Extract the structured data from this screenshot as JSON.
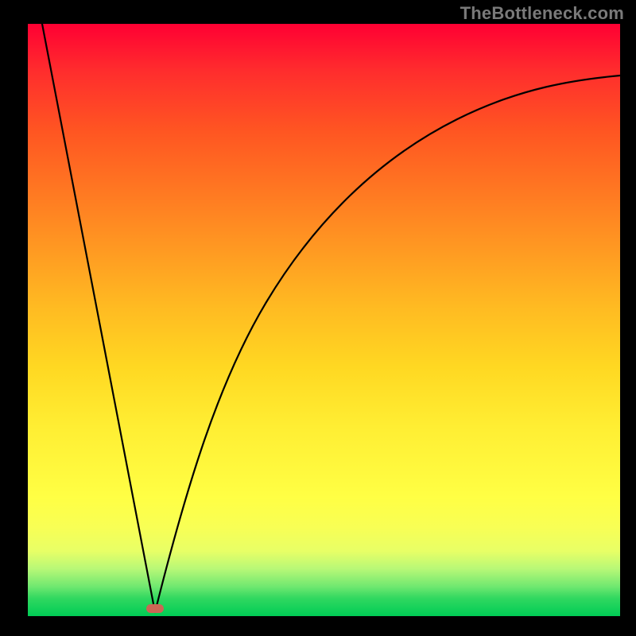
{
  "watermark": "TheBottleneck.com",
  "marker": {
    "x_frac": 0.214,
    "y_frac": 0.993
  },
  "chart_data": {
    "type": "line",
    "title": "",
    "xlabel": "",
    "ylabel": "",
    "xlim": [
      0,
      1
    ],
    "ylim": [
      0,
      1
    ],
    "series": [
      {
        "name": "left-descent",
        "x": [
          0.025,
          0.214
        ],
        "y": [
          1.0,
          0.0
        ]
      },
      {
        "name": "right-ascent",
        "x": [
          0.214,
          0.27,
          0.33,
          0.39,
          0.46,
          0.54,
          0.63,
          0.73,
          0.84,
          0.93,
          1.0
        ],
        "y": [
          0.0,
          0.22,
          0.4,
          0.53,
          0.63,
          0.71,
          0.78,
          0.83,
          0.87,
          0.895,
          0.91
        ]
      }
    ],
    "annotations": [
      {
        "type": "marker",
        "x": 0.214,
        "y": 0.0,
        "shape": "pill",
        "color": "#cc6655"
      }
    ]
  }
}
